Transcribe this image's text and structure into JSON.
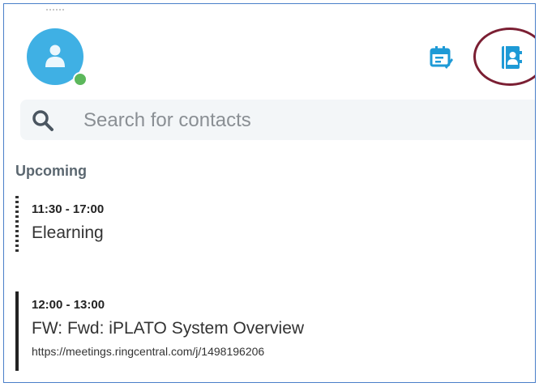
{
  "header": {
    "avatar_icon": "user-avatar-icon",
    "presence_status_color": "#5cb85c",
    "calendar_icon": "calendar-icon",
    "contacts_icon": "contacts-book-icon",
    "highlight_color": "#7b1f33"
  },
  "search": {
    "placeholder": "Search for contacts",
    "icon": "search-icon"
  },
  "upcoming": {
    "title": "Upcoming",
    "events": [
      {
        "time": "11:30 - 17:00",
        "title": "Elearning",
        "bar_style": "dashed"
      },
      {
        "time": "12:00 - 13:00",
        "title": "FW: Fwd: iPLATO System Overview",
        "link": "https://meetings.ringcentral.com/j/1498196206",
        "bar_style": "solid"
      }
    ]
  },
  "colors": {
    "accent": "#1e9ad6",
    "avatar": "#3fb0e4",
    "frame_border": "#4a7fc9"
  }
}
